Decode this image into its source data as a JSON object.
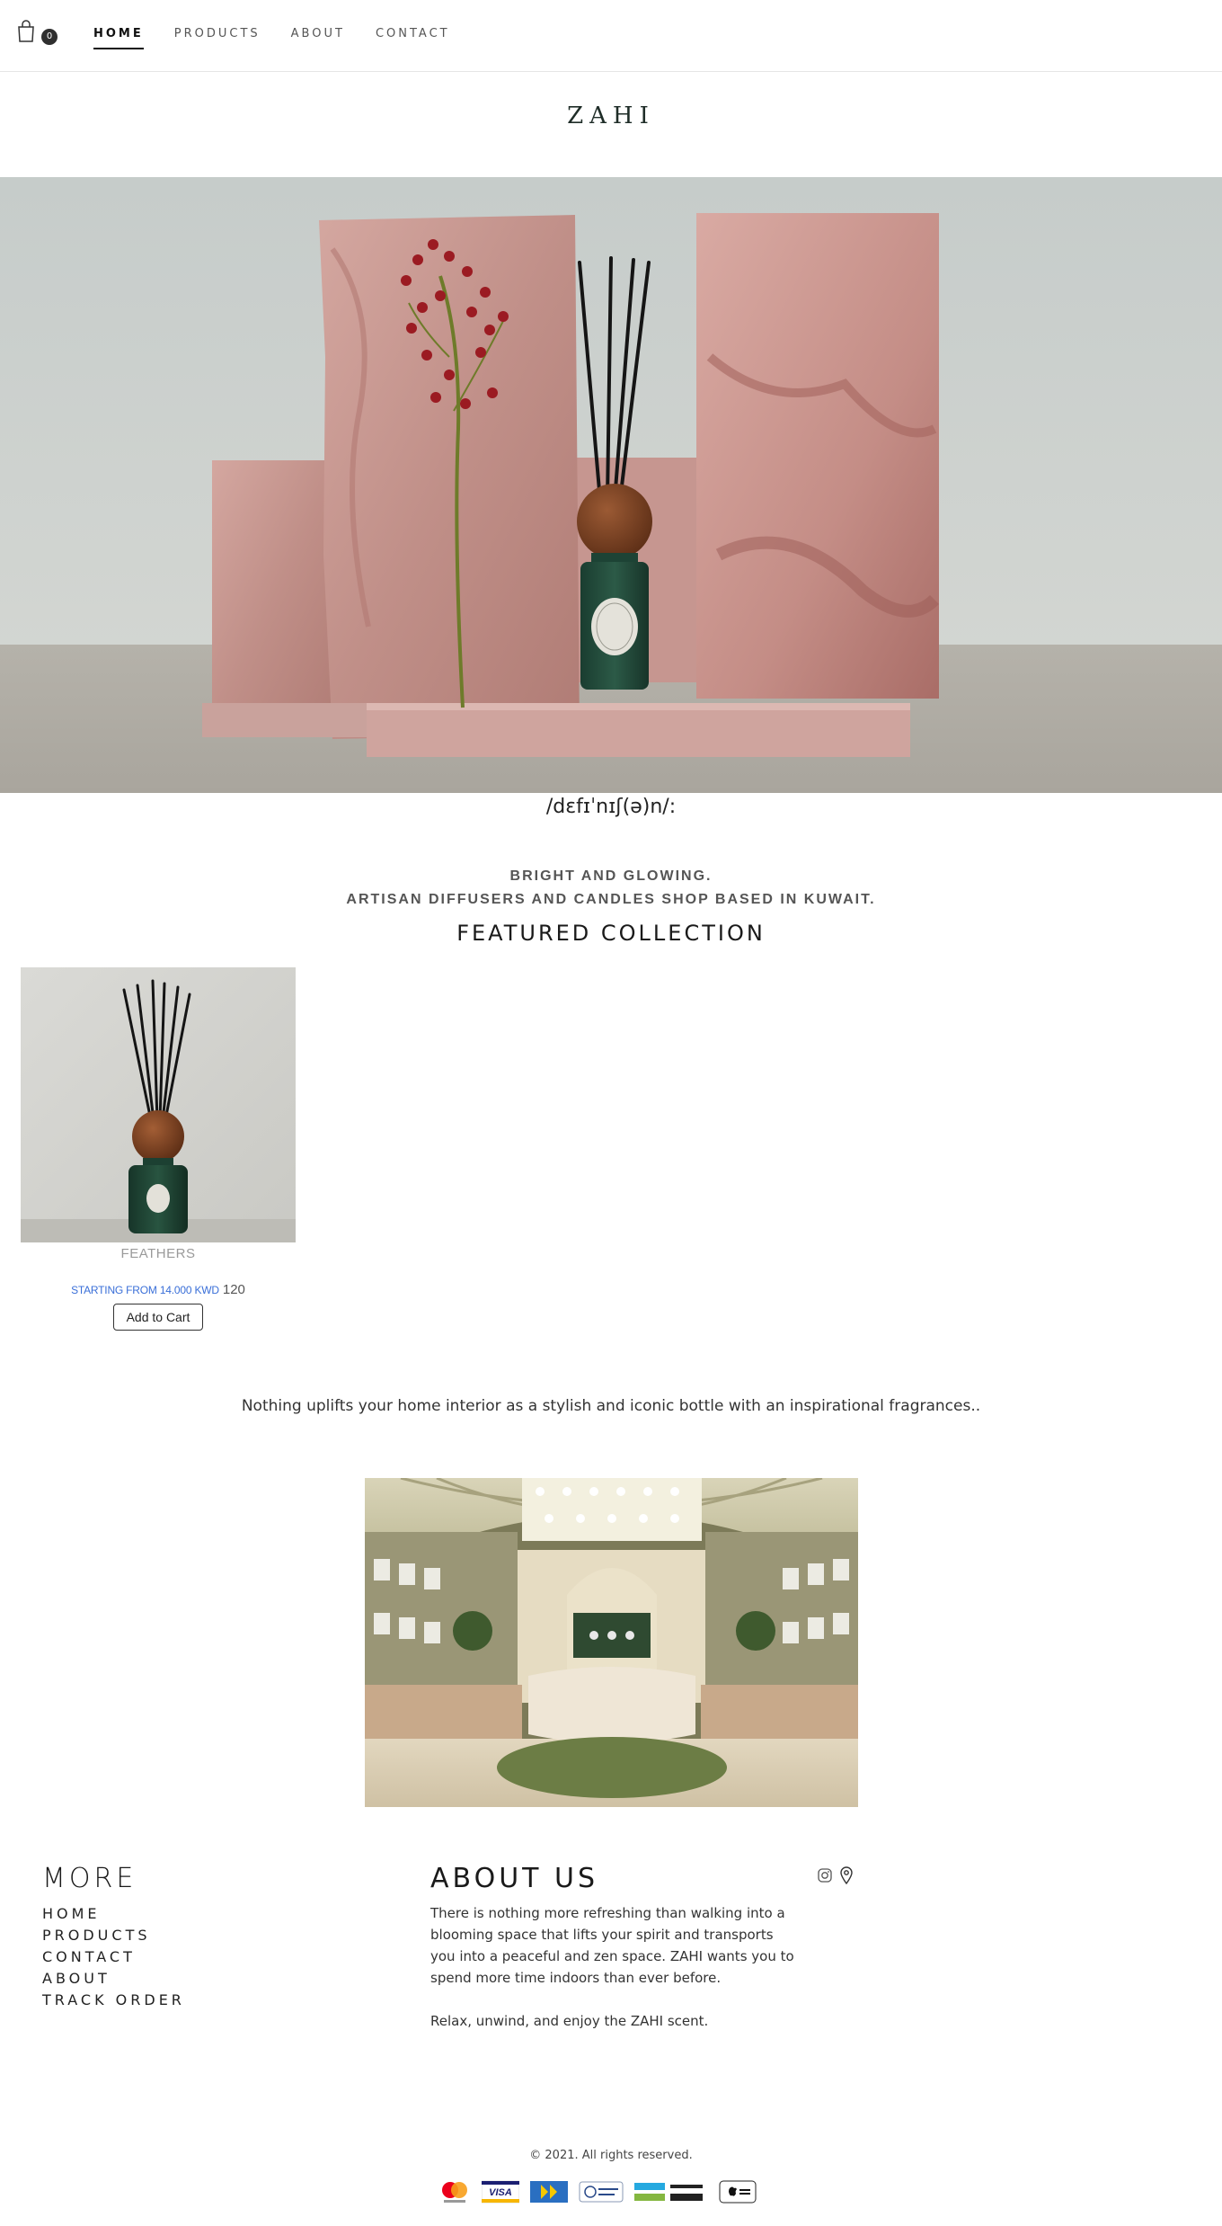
{
  "nav": {
    "cart_count": "0",
    "links": [
      {
        "label": "HOME",
        "active": true
      },
      {
        "label": "PRODUCTS",
        "active": false
      },
      {
        "label": "ABOUT",
        "active": false
      },
      {
        "label": "CONTACT",
        "active": false
      }
    ]
  },
  "logo": "ZAHI",
  "hero": {
    "phonetic": "/dɛfɪˈnɪʃ(ə)n/:"
  },
  "tagline": {
    "line1": "BRIGHT AND GLOWING.",
    "line2": "ARTISAN DIFFUSERS AND CANDLES SHOP BASED IN KUWAIT."
  },
  "featured": {
    "title": "FEATURED COLLECTION",
    "products": [
      {
        "name": "FEATHERS",
        "price_prefix": "STARTING FROM 14.000 KWD",
        "price_value": "120",
        "button_label": "Add to Cart"
      }
    ]
  },
  "uplift_text": "Nothing uplifts your home interior as a stylish and iconic bottle with an inspirational fragrances..",
  "footer": {
    "more_title": "MORE",
    "more_links": [
      "HOME",
      "PRODUCTS",
      "CONTACT",
      "ABOUT",
      "TRACK ORDER"
    ],
    "about_title": "ABOUT US",
    "about_text": "There is nothing more refreshing than walking into a blooming space that lifts your spirit and transports you into a peaceful and zen space. ZAHI wants you to spend more time indoors than ever before.",
    "about_text2": "Relax, unwind, and enjoy the ZAHI scent.",
    "copyright": "© 2021. All rights reserved.",
    "payments": [
      "mastercard-icon",
      "visa-icon",
      "knet-icon",
      "cash-on-delivery-icon",
      "mada-icon",
      "apple-pay-icon"
    ]
  },
  "colors": {
    "accent": "#3a6fd8",
    "dark_green": "#1f4b3a",
    "stone_pink": "#c99b94"
  }
}
